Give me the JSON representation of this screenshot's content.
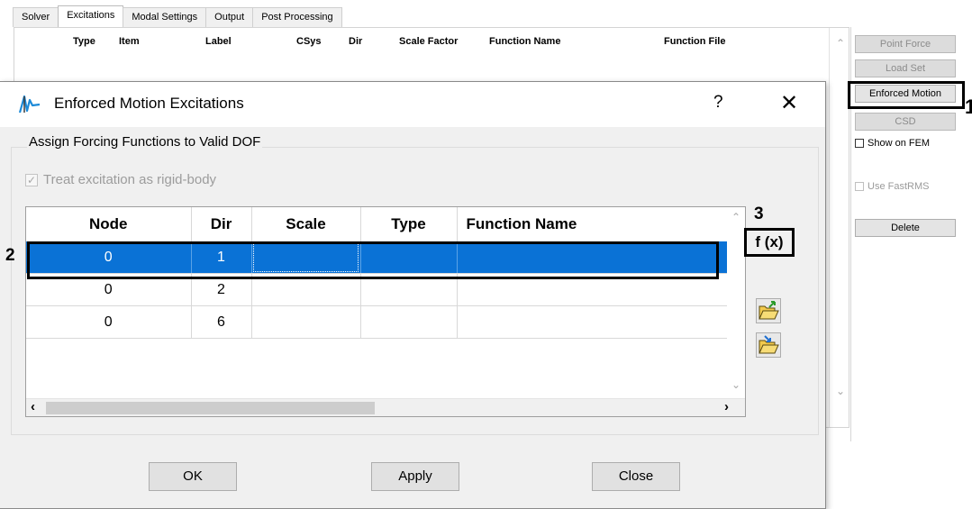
{
  "main": {
    "tabs": [
      "Solver",
      "Excitations",
      "Modal Settings",
      "Output",
      "Post Processing"
    ],
    "active_tab": "Excitations",
    "columns": [
      "Type",
      "Item",
      "Label",
      "CSys",
      "Dir",
      "Scale Factor",
      "Function Name",
      "Function File"
    ],
    "right_panel": {
      "point_force": "Point Force",
      "load_set": "Load Set",
      "enforced_motion": "Enforced Motion",
      "csd": "CSD",
      "show_on_fem": "Show on FEM",
      "use_fastrms": "Use FastRMS",
      "delete": "Delete"
    }
  },
  "dialog": {
    "title": "Enforced Motion Excitations",
    "help": "?",
    "close": "✕",
    "group_label": "Assign Forcing Functions to Valid DOF",
    "rigid_body_label": "Treat excitation as rigid-body",
    "rigid_body_checked": true,
    "table": {
      "columns": [
        "Node",
        "Dir",
        "Scale",
        "Type",
        "Function Name"
      ],
      "rows": [
        {
          "node": "0",
          "dir": "1",
          "scale": "",
          "type": "",
          "function_name": "",
          "selected": true
        },
        {
          "node": "0",
          "dir": "2",
          "scale": "",
          "type": "",
          "function_name": "",
          "selected": false
        },
        {
          "node": "0",
          "dir": "6",
          "scale": "",
          "type": "",
          "function_name": "",
          "selected": false
        }
      ]
    },
    "fx_button": "f (x)",
    "buttons": {
      "ok": "OK",
      "apply": "Apply",
      "close": "Close"
    }
  },
  "annotations": {
    "one": "1",
    "two": "2",
    "three": "3"
  },
  "colors": {
    "selection": "#0a72d6",
    "dialog_bg": "#f0f0f0",
    "icon_blue": "#0078d7"
  },
  "icons": [
    "app-wave-icon",
    "folder-open-arrow-icon",
    "folder-import-arrow-icon"
  ]
}
